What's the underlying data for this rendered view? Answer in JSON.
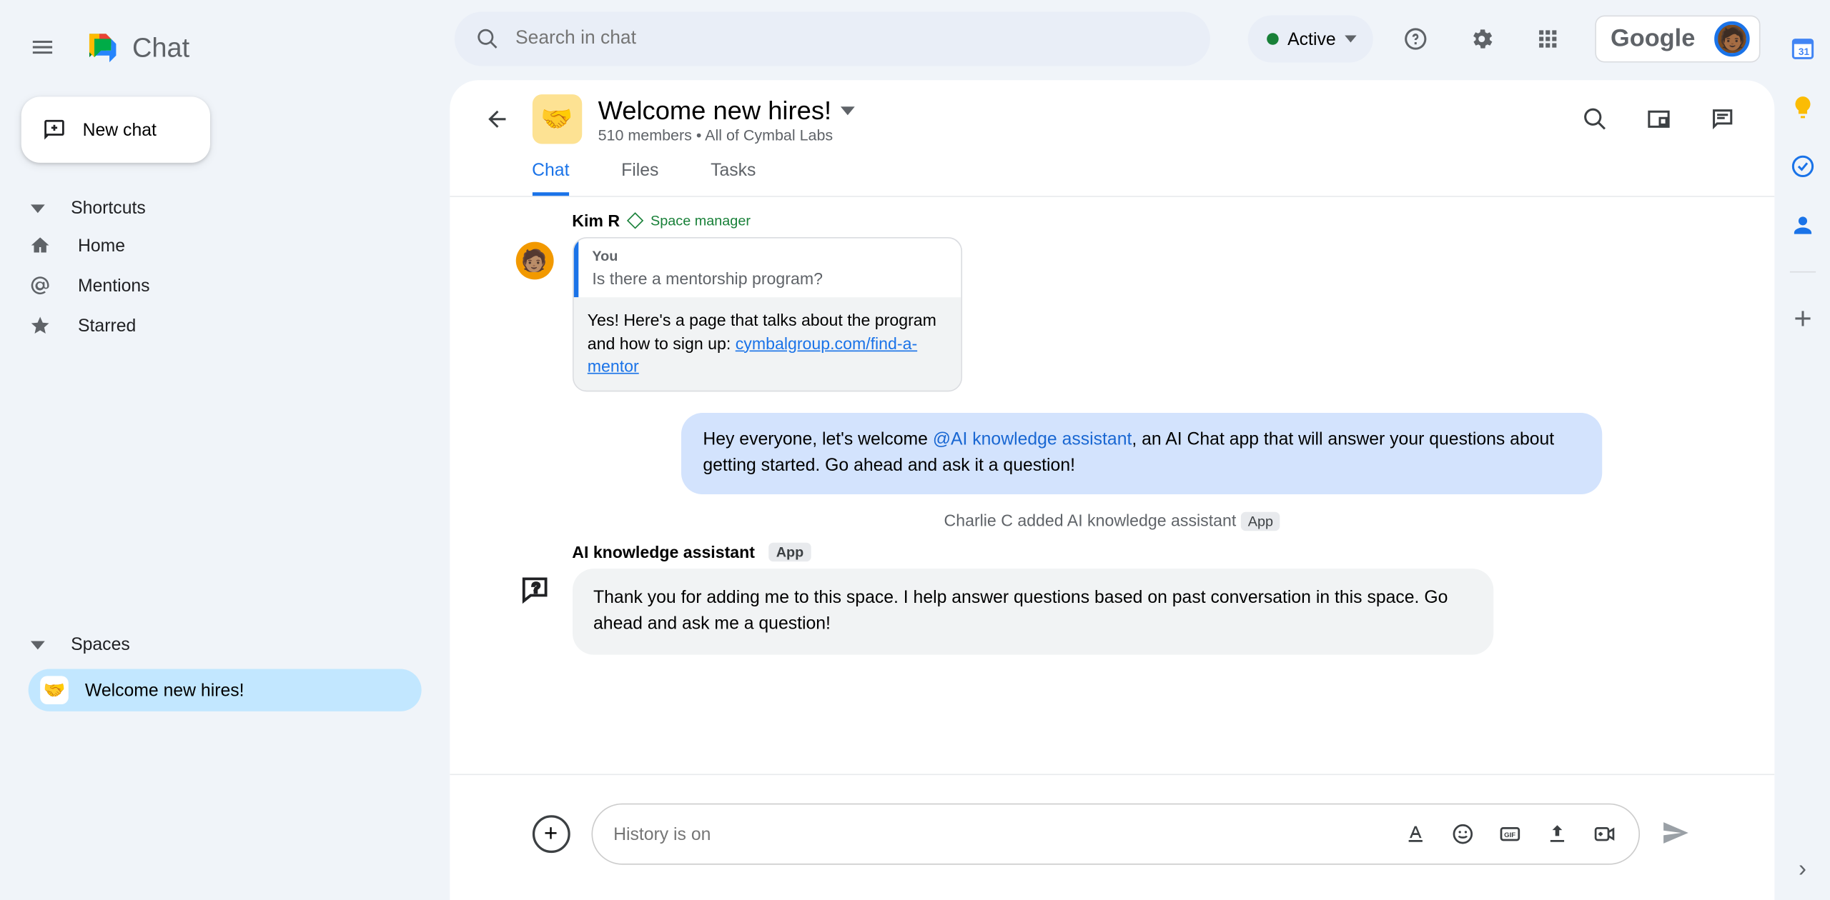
{
  "header": {
    "app_name": "Chat",
    "search_placeholder": "Search in chat",
    "status_label": "Active",
    "google_label": "Google"
  },
  "sidebar": {
    "new_chat": "New chat",
    "shortcuts_label": "Shortcuts",
    "home": "Home",
    "mentions": "Mentions",
    "starred": "Starred",
    "spaces_label": "Spaces",
    "spaces": [
      {
        "emoji": "🤝",
        "name": "Welcome new hires!"
      }
    ]
  },
  "space_header": {
    "emoji": "🤝",
    "title": "Welcome new hires!",
    "subtitle": "510 members  •  All of Cymbal Labs",
    "tabs": [
      "Chat",
      "Files",
      "Tasks"
    ],
    "active_tab": 0
  },
  "messages": {
    "kim": {
      "sender": "Kim R",
      "role": "Space manager",
      "quote_you": "You",
      "quote_q": "Is there a mentorship program?",
      "answer_prefix": "Yes! Here's a page that talks about the program and how to sign up: ",
      "answer_link": "cymbalgroup.com/find-a-mentor"
    },
    "self": {
      "pre": "Hey everyone, let's welcome ",
      "mention": "@AI knowledge assistant",
      "post": ", an AI Chat app that will answer your questions about getting started.  Go ahead and ask it a question!"
    },
    "system": {
      "text": "Charlie C added AI knowledge assistant",
      "badge": "App"
    },
    "bot": {
      "sender": "AI knowledge assistant",
      "badge": "App",
      "text": "Thank you for adding me to this space. I help answer questions based on past conversation in this space. Go ahead and ask me a question!"
    }
  },
  "compose": {
    "placeholder": "History is on"
  }
}
